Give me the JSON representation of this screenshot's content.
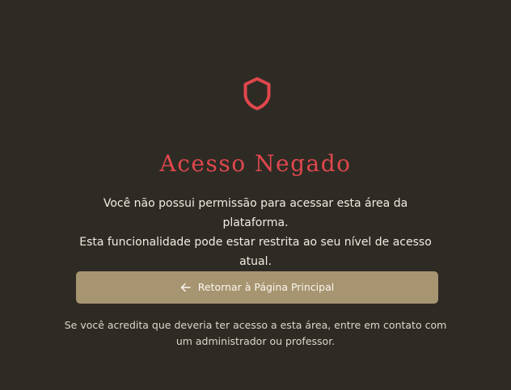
{
  "page": {
    "background_color": "#2e2b25",
    "icon": "shield-icon",
    "title": "Acesso Negado",
    "title_color": "#e0474c",
    "message_line1": "Você não possui permissão para acessar esta área da plataforma.",
    "message_line2": "Esta funcionalidade pode estar restrita ao seu nível de acesso atual.",
    "text_color": "#f1ece2",
    "back_button": {
      "icon": "arrow-left-icon",
      "label": "Retornar à Página Principal",
      "background_color": "#a79470",
      "text_color": "#faf7f1"
    },
    "contact_note": "Se você acredita que deveria ter acesso a esta área, entre em contato com um administrador ou professor.",
    "contact_note_color": "#ddd6c9"
  }
}
